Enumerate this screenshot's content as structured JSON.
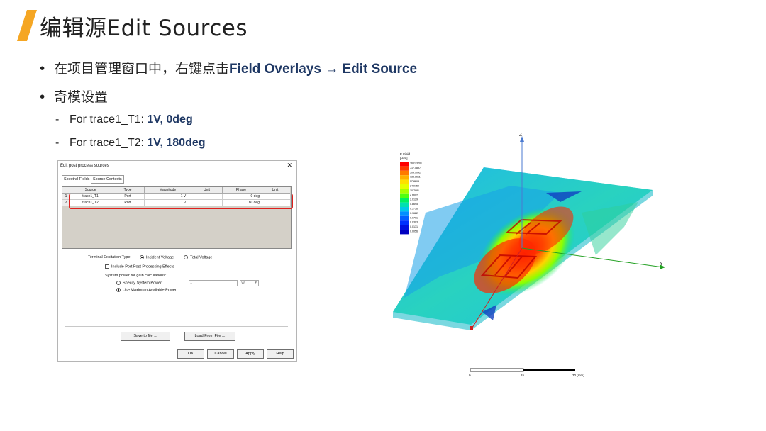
{
  "slide": {
    "title": "编辑源Edit Sources",
    "accent_color": "#f5a623",
    "bullets": [
      {
        "text": "在项目管理窗口中，右键点击",
        "bold": "Field Overlays → Edit Source"
      },
      {
        "text": "奇模设置",
        "bold": ""
      }
    ],
    "subitems": [
      {
        "prefix": "-",
        "text": "For trace1_T1: ",
        "bold": "1V, 0deg"
      },
      {
        "prefix": "-",
        "text": "For trace1_T2: ",
        "bold": "1V, 180deg"
      }
    ]
  },
  "dialog": {
    "title": "Edit post process sources",
    "tabs": [
      "Spectral Fields",
      "Source Contexts"
    ],
    "columns": [
      "Source",
      "Type",
      "Magnitude",
      "Unit",
      "Phase",
      "Unit"
    ],
    "rows": [
      {
        "index": "1",
        "source": "trace1_T1",
        "type": "Port",
        "magnitude": "1 V",
        "phase": "0 deg"
      },
      {
        "index": "2",
        "source": "trace1_T2",
        "type": "Port",
        "magnitude": "1 V",
        "phase": "180 deg"
      }
    ],
    "excitation_label": "Terminal Excitation Type:",
    "excitation_options": [
      "Incident Voltage",
      "Total Voltage"
    ],
    "include_post_label": "Include Port Post Processing Effects",
    "system_power_label": "System power for gain calculations:",
    "specify_power_label": "Specify System Power:",
    "power_value": "1",
    "power_unit": "W",
    "max_power_label": "Use Maximum Available Power",
    "buttons": {
      "save": "Save to file ...",
      "load": "Load From File ...",
      "ok": "OK",
      "cancel": "Cancel",
      "apply": "Apply",
      "help": "Help"
    },
    "highlight_color": "#e0201d"
  },
  "field_view": {
    "legend_title": [
      "E Field",
      "[V/m]"
    ],
    "legend_values": [
      "1661.3201",
      "717.5897",
      "309.9042",
      "133.8611",
      "57.8203",
      "24.9750",
      "10.7881",
      "4.6602",
      "2.0129",
      "0.8695",
      "0.3756",
      "0.1622",
      "0.0701",
      "0.0303",
      "0.0131",
      "0.0056"
    ],
    "legend_colors": [
      "#ff0000",
      "#ff3a00",
      "#ff7a00",
      "#ffb000",
      "#ffe000",
      "#e6ff00",
      "#a8ff00",
      "#50ff10",
      "#00f060",
      "#00e0b0",
      "#00c8e8",
      "#0090ff",
      "#0060ff",
      "#0030ff",
      "#0010e0",
      "#0000c0"
    ],
    "axis_labels": {
      "z": "Z",
      "y": "Y"
    },
    "scale_labels": [
      "0",
      "15",
      "30 (mm)"
    ]
  }
}
